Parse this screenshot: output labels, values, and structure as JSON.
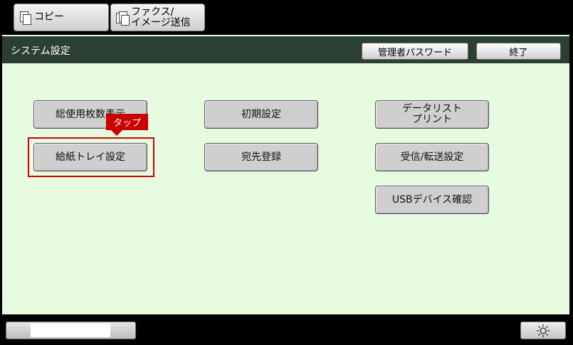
{
  "tabs": [
    {
      "label": "コピー",
      "icon": "copy-icon"
    },
    {
      "label": "ファクス/\nイメージ送信",
      "icon": "fax-icon"
    }
  ],
  "header": {
    "title": "システム設定",
    "admin_password_label": "管理者パスワード",
    "end_label": "終了"
  },
  "buttons": {
    "total_usage": "総使用枚数表示",
    "initial_settings": "初期設定",
    "data_list_print": "データリスト\nプリント",
    "paper_tray_settings": "給紙トレイ設定",
    "address_registration": "宛先登録",
    "receive_forward_settings": "受信/転送設定",
    "usb_device_check": "USBデバイス確認"
  },
  "callout": {
    "label": "タップ",
    "color": "#c80000"
  },
  "footer": {
    "brightness_icon": "brightness-icon"
  },
  "colors": {
    "panel": "#e6fbe0",
    "titlebar": "#2b3f32",
    "highlight": "#d40000"
  }
}
